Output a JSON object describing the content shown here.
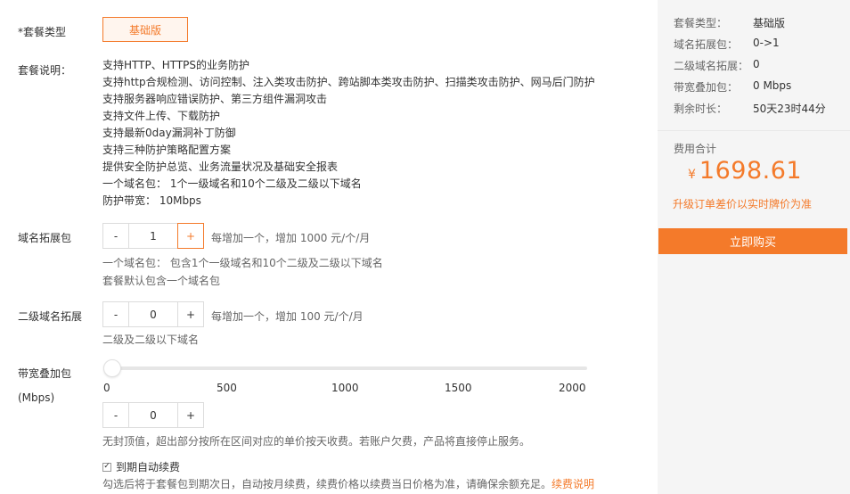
{
  "package_type": {
    "label": "*套餐类型",
    "selected": "基础版"
  },
  "package_description": {
    "label": "套餐说明：",
    "lines": [
      "支持HTTP、HTTPS的业务防护",
      "支持http合规检测、访问控制、注入类攻击防护、跨站脚本类攻击防护、扫描类攻击防护、网马后门防护",
      "支持服务器响应错误防护、第三方组件漏洞攻击",
      "支持文件上传、下载防护",
      "支持最新0day漏洞补丁防御",
      "支持三种防护策略配置方案",
      "提供安全防护总览、业务流量状况及基础安全报表",
      "一个域名包： 1个一级域名和10个二级及二级以下域名",
      "防护带宽： 10Mbps"
    ]
  },
  "domain_expansion": {
    "label": "域名拓展包",
    "minus": "-",
    "value": "1",
    "plus": "+",
    "price_hint": "每增加一个，增加 1000 元/个/月",
    "note1": "一个域名包： 包含1个一级域名和10个二级及二级以下域名",
    "note2": "套餐默认包含一个域名包"
  },
  "subdomain_expansion": {
    "label": "二级域名拓展",
    "minus": "-",
    "value": "0",
    "plus": "+",
    "price_hint": "每增加一个，增加 100 元/个/月",
    "note": "二级及二级以下域名"
  },
  "bandwidth": {
    "label": "带宽叠加包",
    "unit_label": "(Mbps)",
    "slider_value": 0,
    "slider_max": 2000,
    "ticks": [
      "0",
      "500",
      "1000",
      "1500",
      "2000"
    ],
    "minus": "-",
    "value": "0",
    "plus": "+",
    "note": "无封顶值，超出部分按所在区间对应的单价按天收费。若账户欠费，产品将直接停止服务。"
  },
  "auto_renew": {
    "checked": true,
    "check_mark": "✓",
    "label": "到期自动续费",
    "note": "勾选后将于套餐包到期次日，自动按月续费，续费价格以续费当日价格为准，请确保余额充足。",
    "link": "续费说明"
  },
  "summary": {
    "rows": [
      {
        "label": "套餐类型：",
        "value": "基础版"
      },
      {
        "label": "域名拓展包：",
        "value": "0->1"
      },
      {
        "label": "二级域名拓展：",
        "value": "0"
      },
      {
        "label": "带宽叠加包：",
        "value": "0 Mbps"
      },
      {
        "label": "剩余时长：",
        "value": "50天23时44分"
      }
    ],
    "fee_label": "费用合计",
    "currency": "¥",
    "total": "1698.61",
    "fee_note": "升级订单差价以实时牌价为准",
    "buy_label": "立即购买"
  },
  "colors": {
    "accent": "#f47a2a",
    "panel_bg": "#f5f5f5"
  }
}
